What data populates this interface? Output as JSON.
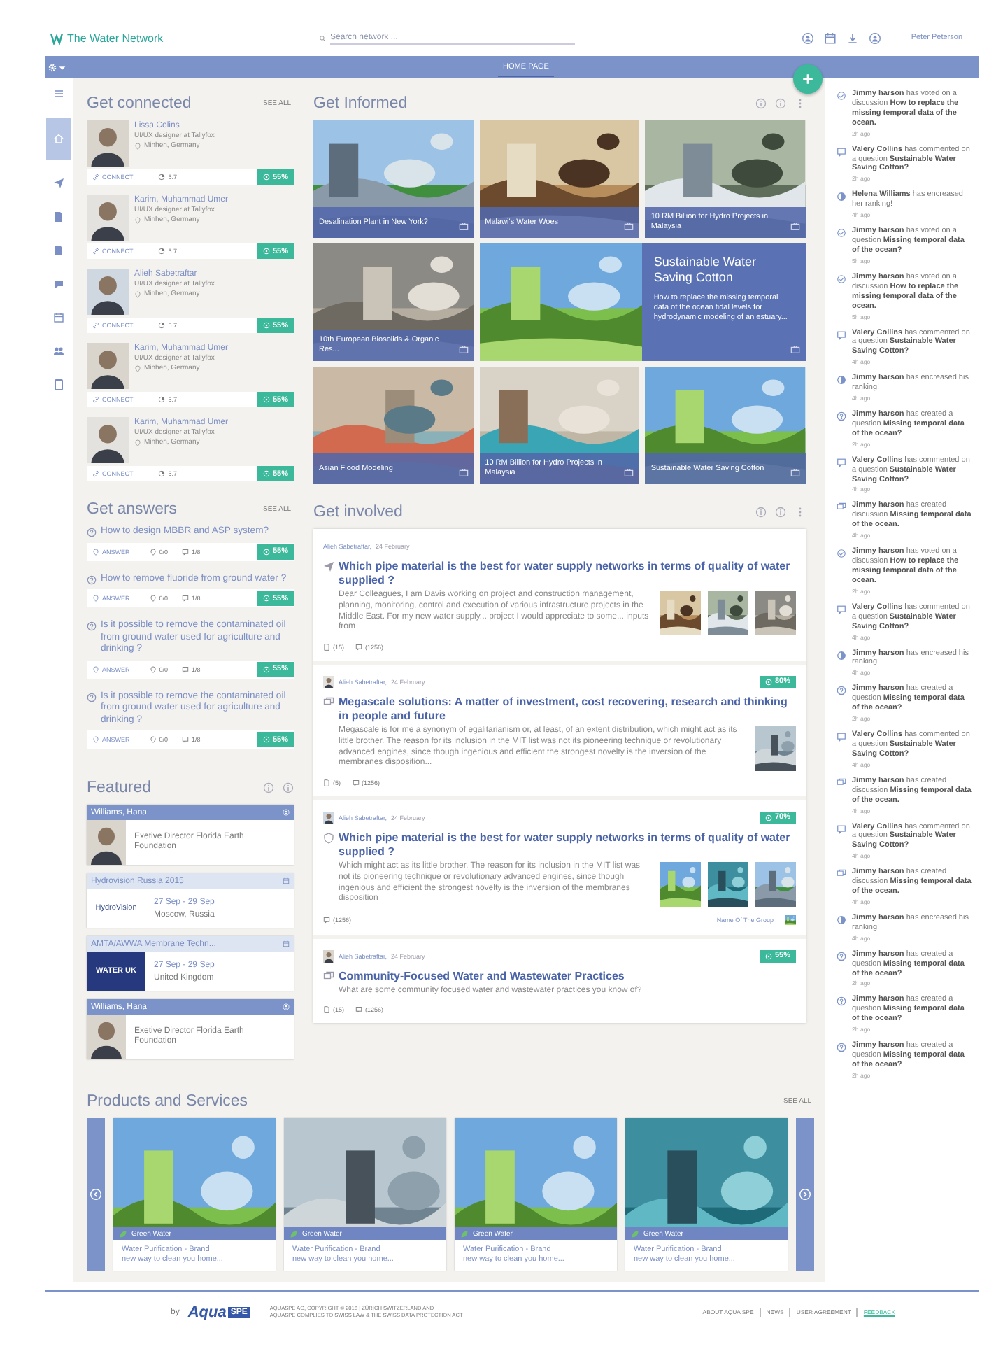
{
  "header": {
    "logo": "The Water Network",
    "search": {
      "placeholder": "Search network ..."
    },
    "user": "Peter Peterson"
  },
  "navbar": {
    "title": "HOME PAGE"
  },
  "rail": [
    {
      "kind": "menu",
      "selected": false
    },
    {
      "kind": "home",
      "selected": true
    },
    {
      "kind": "send",
      "selected": false
    },
    {
      "kind": "doc",
      "selected": false
    },
    {
      "kind": "doc",
      "selected": false
    },
    {
      "kind": "chat",
      "selected": false
    },
    {
      "kind": "calendar",
      "selected": false
    },
    {
      "kind": "group",
      "selected": false
    },
    {
      "kind": "file",
      "selected": false
    }
  ],
  "connected": {
    "title": "Get connected",
    "see_all": "SEE ALL",
    "people": [
      {
        "name": "Lissa Colins",
        "role": "UI/UX designer at Tallyfox",
        "location": "Minhen, Germany",
        "action": "CONNECT",
        "score": "5.7",
        "match": "55%"
      },
      {
        "name": "Karim, Muhammad Umer",
        "role": "UI/UX designer at Tallyfox",
        "location": "Minhen, Germany",
        "action": "CONNECT",
        "score": "5.7",
        "match": "55%"
      },
      {
        "name": "Alieh Sabetraftar",
        "role": "UI/UX designer at Tallyfox",
        "location": "Minhen, Germany",
        "action": "CONNECT",
        "score": "5.7",
        "match": "55%"
      },
      {
        "name": "Karim, Muhammad Umer",
        "role": "UI/UX designer at Tallyfox",
        "location": "Minhen, Germany",
        "action": "CONNECT",
        "score": "5.7",
        "match": "55%"
      },
      {
        "name": "Karim, Muhammad Umer",
        "role": "UI/UX designer at Tallyfox",
        "location": "Minhen, Germany",
        "action": "CONNECT",
        "score": "5.7",
        "match": "55%"
      }
    ]
  },
  "answers": {
    "title": "Get answers",
    "see_all": "SEE ALL",
    "questions": [
      {
        "text": "How to design MBBR and ASP system?",
        "action": "ANSWER",
        "votes": "0/0",
        "comments": "1/8",
        "match": "55%"
      },
      {
        "text": "How to remove fluoride from ground water ?",
        "action": "ANSWER",
        "votes": "0/0",
        "comments": "1/8",
        "match": "55%"
      },
      {
        "text": "Is it possible to remove the contaminated oil from ground water used for agriculture and drinking ?",
        "action": "ANSWER",
        "votes": "0/0",
        "comments": "1/8",
        "match": "55%"
      },
      {
        "text": "Is it possible to remove the contaminated oil from ground water used for agriculture and drinking ?",
        "action": "ANSWER",
        "votes": "0/0",
        "comments": "1/8",
        "match": "55%"
      }
    ]
  },
  "featured": {
    "title": "Featured",
    "items": [
      {
        "kind": "person",
        "title": "Williams, Hana",
        "text": "Exetive Director Florida Earth Foundation"
      },
      {
        "kind": "event",
        "title": "Hydrovision Russia 2015",
        "logo": {
          "kind": "wordmark",
          "text": "HydroVision"
        },
        "date": "27 Sep - 29 Sep",
        "place": "Moscow, Russia"
      },
      {
        "kind": "event",
        "title": "AMTA/AWWA Membrane Techn...",
        "logo": {
          "kind": "banner",
          "text": "WATER UK"
        },
        "date": "27 Sep - 29 Sep",
        "place": "United Kingdom"
      },
      {
        "kind": "person",
        "title": "Williams, Hana",
        "text": "Exetive Director Florida Earth Foundation"
      }
    ]
  },
  "informed": {
    "title": "Get Informed",
    "tiles": [
      {
        "caption": "Desalination Plant in New York?"
      },
      {
        "caption": "Malawi's Water Woes"
      },
      {
        "caption": "10 RM Billion for Hydro Projects in Malaysia"
      },
      {
        "caption": "10th European Biosolids & Organic Res..."
      },
      {
        "kind": "feature",
        "title": "Sustainable Water Saving Cotton",
        "text": "How to replace the missing temporal data of the ocean tidal levels for hydrodynamic modeling of an estuary..."
      },
      {
        "caption": "Asian Flood Modeling"
      },
      {
        "caption": "10 RM Billion for Hydro Projects in Malaysia"
      },
      {
        "caption": "Sustainable Water Saving Cotton"
      }
    ]
  },
  "involved": {
    "title": "Get involved",
    "posts": [
      {
        "kind": "question",
        "avatar": false,
        "author": "Alieh Sabetraftar,",
        "date": "24 February",
        "title": "Which pipe material is the best for water supply networks in terms of quality of water supplied ?",
        "body": "Dear Colleagues, I am Davis working on project and construction management, planning, monitoring, control and execution of various infrastructure projects in the Middle East. For my new water supply... project I would appreciate to some... inputs from",
        "images": [
          {
            "kind": "picture"
          },
          {
            "kind": "picture"
          },
          {
            "kind": "picture"
          }
        ],
        "counts": [
          {
            "kind": "attachment",
            "text": "(15)"
          },
          {
            "kind": "comment",
            "text": "(1256)"
          }
        ]
      },
      {
        "kind": "discussion",
        "avatar": true,
        "author": "Alieh Sabetraftar,",
        "date": "24 February",
        "match": "80%",
        "title": "Megascale solutions: A matter of investment, cost recovering, research and thinking in people and future",
        "body": "Megascale is for me a synonym of egalitarianism or, at least, of an extent distribution, which might act as its little brother. The reason for its inclusion in the MIT list was not its pioneering technique or revolutionary advanced engines, since though ingenious and efficient the strongest novelty is the inversion of the membranes disposition...",
        "images": [
          {
            "kind": "picture"
          }
        ],
        "counts": [
          {
            "kind": "attachment",
            "text": "(5)"
          },
          {
            "kind": "comment",
            "text": "(1256)"
          }
        ]
      },
      {
        "kind": "group",
        "avatar": true,
        "author": "Alieh Sabetraftar,",
        "date": "24 February",
        "match": "70%",
        "title": "Which pipe material is the best for water supply networks in terms of quality of water supplied ?",
        "body": "Which might act as its little brother. The reason for its inclusion in the MIT list was not its pioneering technique or revolutionary advanced engines, since though ingenious and efficient the strongest novelty is the inversion of the membranes disposition",
        "images": [
          {
            "kind": "picture"
          },
          {
            "kind": "picture"
          },
          {
            "kind": "picture"
          }
        ],
        "counts": [
          {
            "kind": "comment",
            "text": "(1256)"
          }
        ],
        "group": "Name Of The Group"
      },
      {
        "kind": "discussion",
        "avatar": true,
        "author": "Alieh Sabetraftar,",
        "date": "24 February",
        "match": "55%",
        "title": "Community-Focused Water and Wastewater Practices",
        "body": "What are some community focused water and wastewater practices you know of?",
        "counts": [
          {
            "kind": "attachment",
            "text": "(15)"
          },
          {
            "kind": "comment",
            "text": "(1256)"
          }
        ]
      }
    ]
  },
  "products": {
    "title": "Products and Services",
    "see_all": "SEE ALL",
    "items": [
      {
        "tag": "Green Water",
        "title": "Water Purification - Brand",
        "desc": "new way to clean you home..."
      },
      {
        "tag": "Green Water",
        "title": "Water Purification - Brand",
        "desc": "new way to clean you home..."
      },
      {
        "tag": "Green Water",
        "title": "Water Purification - Brand",
        "desc": "new way to clean you home..."
      },
      {
        "tag": "Green Water",
        "title": "Water Purification - Brand",
        "desc": "new way to clean you home..."
      }
    ]
  },
  "feed": [
    {
      "kind": "vote",
      "text": "**Jimmy harson** has voted on a discussion **How to replace the missing temporal data of the ocean.**",
      "time": "2h ago"
    },
    {
      "kind": "comment",
      "text": "**Valery Collins** has commented on a question **Sustainable Water Saving Cotton?**",
      "time": "2h ago"
    },
    {
      "kind": "rank",
      "text": "**Helena Williams** has encreased her ranking!",
      "time": "4h ago"
    },
    {
      "kind": "vote",
      "text": "**Jimmy harson** has voted on a question **Missing temporal data of the ocean?**",
      "time": "5h ago"
    },
    {
      "kind": "vote",
      "text": "**Jimmy harson** has voted on a discussion **How to replace the missing temporal data of the ocean.**",
      "time": "5h ago"
    },
    {
      "kind": "comment",
      "text": "**Valery Collins** has commented on a question **Sustainable Water Saving Cotton?**",
      "time": "4h ago"
    },
    {
      "kind": "rank",
      "text": "**Jimmy harson** has encreased his ranking!",
      "time": "4h ago"
    },
    {
      "kind": "question",
      "text": "**Jimmy harson** has created a question **Missing temporal data of the ocean?**",
      "time": "2h ago"
    },
    {
      "kind": "comment",
      "text": "**Valery Collins** has commented on a question **Sustainable Water Saving Cotton?**",
      "time": "4h ago"
    },
    {
      "kind": "discussion",
      "text": "**Jimmy harson** has created discussion **Missing temporal data of the ocean.**",
      "time": "4h ago"
    },
    {
      "kind": "vote",
      "text": "**Jimmy harson** has voted on a discussion **How to replace the missing temporal data of the ocean.**",
      "time": "2h ago"
    },
    {
      "kind": "comment",
      "text": "**Valery Collins** has commented on a question **Sustainable Water Saving Cotton?**",
      "time": "4h ago"
    },
    {
      "kind": "rank",
      "text": "**Jimmy harson** has encreased his ranking!",
      "time": "4h ago"
    },
    {
      "kind": "question",
      "text": "**Jimmy harson** has created a question **Missing temporal data of the ocean?**",
      "time": "2h ago"
    },
    {
      "kind": "comment",
      "text": "**Valery Collins** has commented on a question **Sustainable Water Saving Cotton?**",
      "time": "4h ago"
    },
    {
      "kind": "discussion",
      "text": "**Jimmy harson** has created discussion **Missing temporal data of the ocean.**",
      "time": "4h ago"
    },
    {
      "kind": "comment",
      "text": "**Valery Collins** has commented on a question **Sustainable Water Saving Cotton?**",
      "time": "4h ago"
    },
    {
      "kind": "discussion",
      "text": "**Jimmy harson** has created discussion **Missing temporal data of the ocean.**",
      "time": "4h ago"
    },
    {
      "kind": "rank",
      "text": "**Jimmy harson** has encreased his ranking!",
      "time": "4h ago"
    },
    {
      "kind": "question",
      "text": "**Jimmy harson** has created a question **Missing temporal data of the ocean?**",
      "time": "2h ago"
    },
    {
      "kind": "question",
      "text": "**Jimmy harson** has created a question **Missing temporal data of the ocean?**",
      "time": "2h ago"
    },
    {
      "kind": "question",
      "text": "**Jimmy harson** has created a question **Missing temporal data of the ocean?**",
      "time": "2h ago"
    }
  ],
  "footer": {
    "by": "by",
    "brand": "Aqua",
    "brand_mark": "SPE",
    "legal": [
      "AQUASPE AG, COPYRIGHT © 2016 | ZÜRICH SWITZERLAND AND",
      "AQUASPE COMPLIES TO SWISS LAW & THE SWISS DATA PROTECTION ACT"
    ],
    "links": [
      {
        "label": "ABOUT AQUA SPE",
        "selected": false
      },
      {
        "label": "NEWS",
        "selected": false
      },
      {
        "label": "USER AGREEMENT",
        "selected": false
      },
      {
        "label": "FEEDBACK",
        "selected": true
      }
    ]
  }
}
